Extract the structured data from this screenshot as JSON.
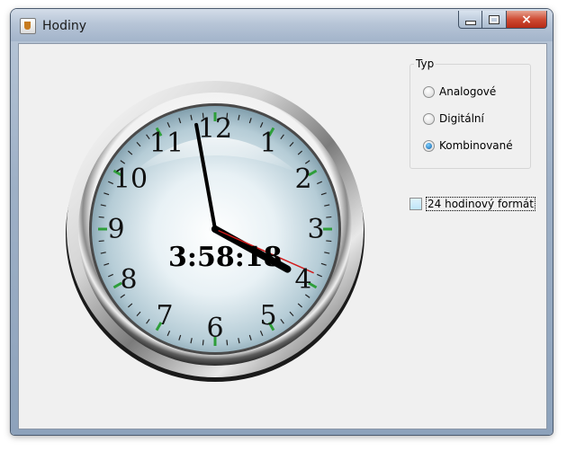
{
  "window": {
    "title": "Hodiny",
    "buttons": {
      "minimize": "minimize",
      "maximize": "maximize",
      "close": "×"
    }
  },
  "clock": {
    "digital_time": "3:58:18",
    "numerals": [
      "12",
      "1",
      "2",
      "3",
      "4",
      "5",
      "6",
      "7",
      "8",
      "9",
      "10",
      "11"
    ],
    "time": {
      "hours": 3,
      "minutes": 58,
      "seconds": 18
    },
    "colors": {
      "tick_marks": "#2e9e3a",
      "second_hand": "#d21a1a",
      "hands": "#000000"
    }
  },
  "type_group": {
    "legend": "Typ",
    "options": [
      {
        "label": "Analogové",
        "checked": false
      },
      {
        "label": "Digitální",
        "checked": false
      },
      {
        "label": "Kombinované",
        "checked": true
      }
    ]
  },
  "format_checkbox": {
    "label": "24 hodinový formát",
    "checked": false
  }
}
